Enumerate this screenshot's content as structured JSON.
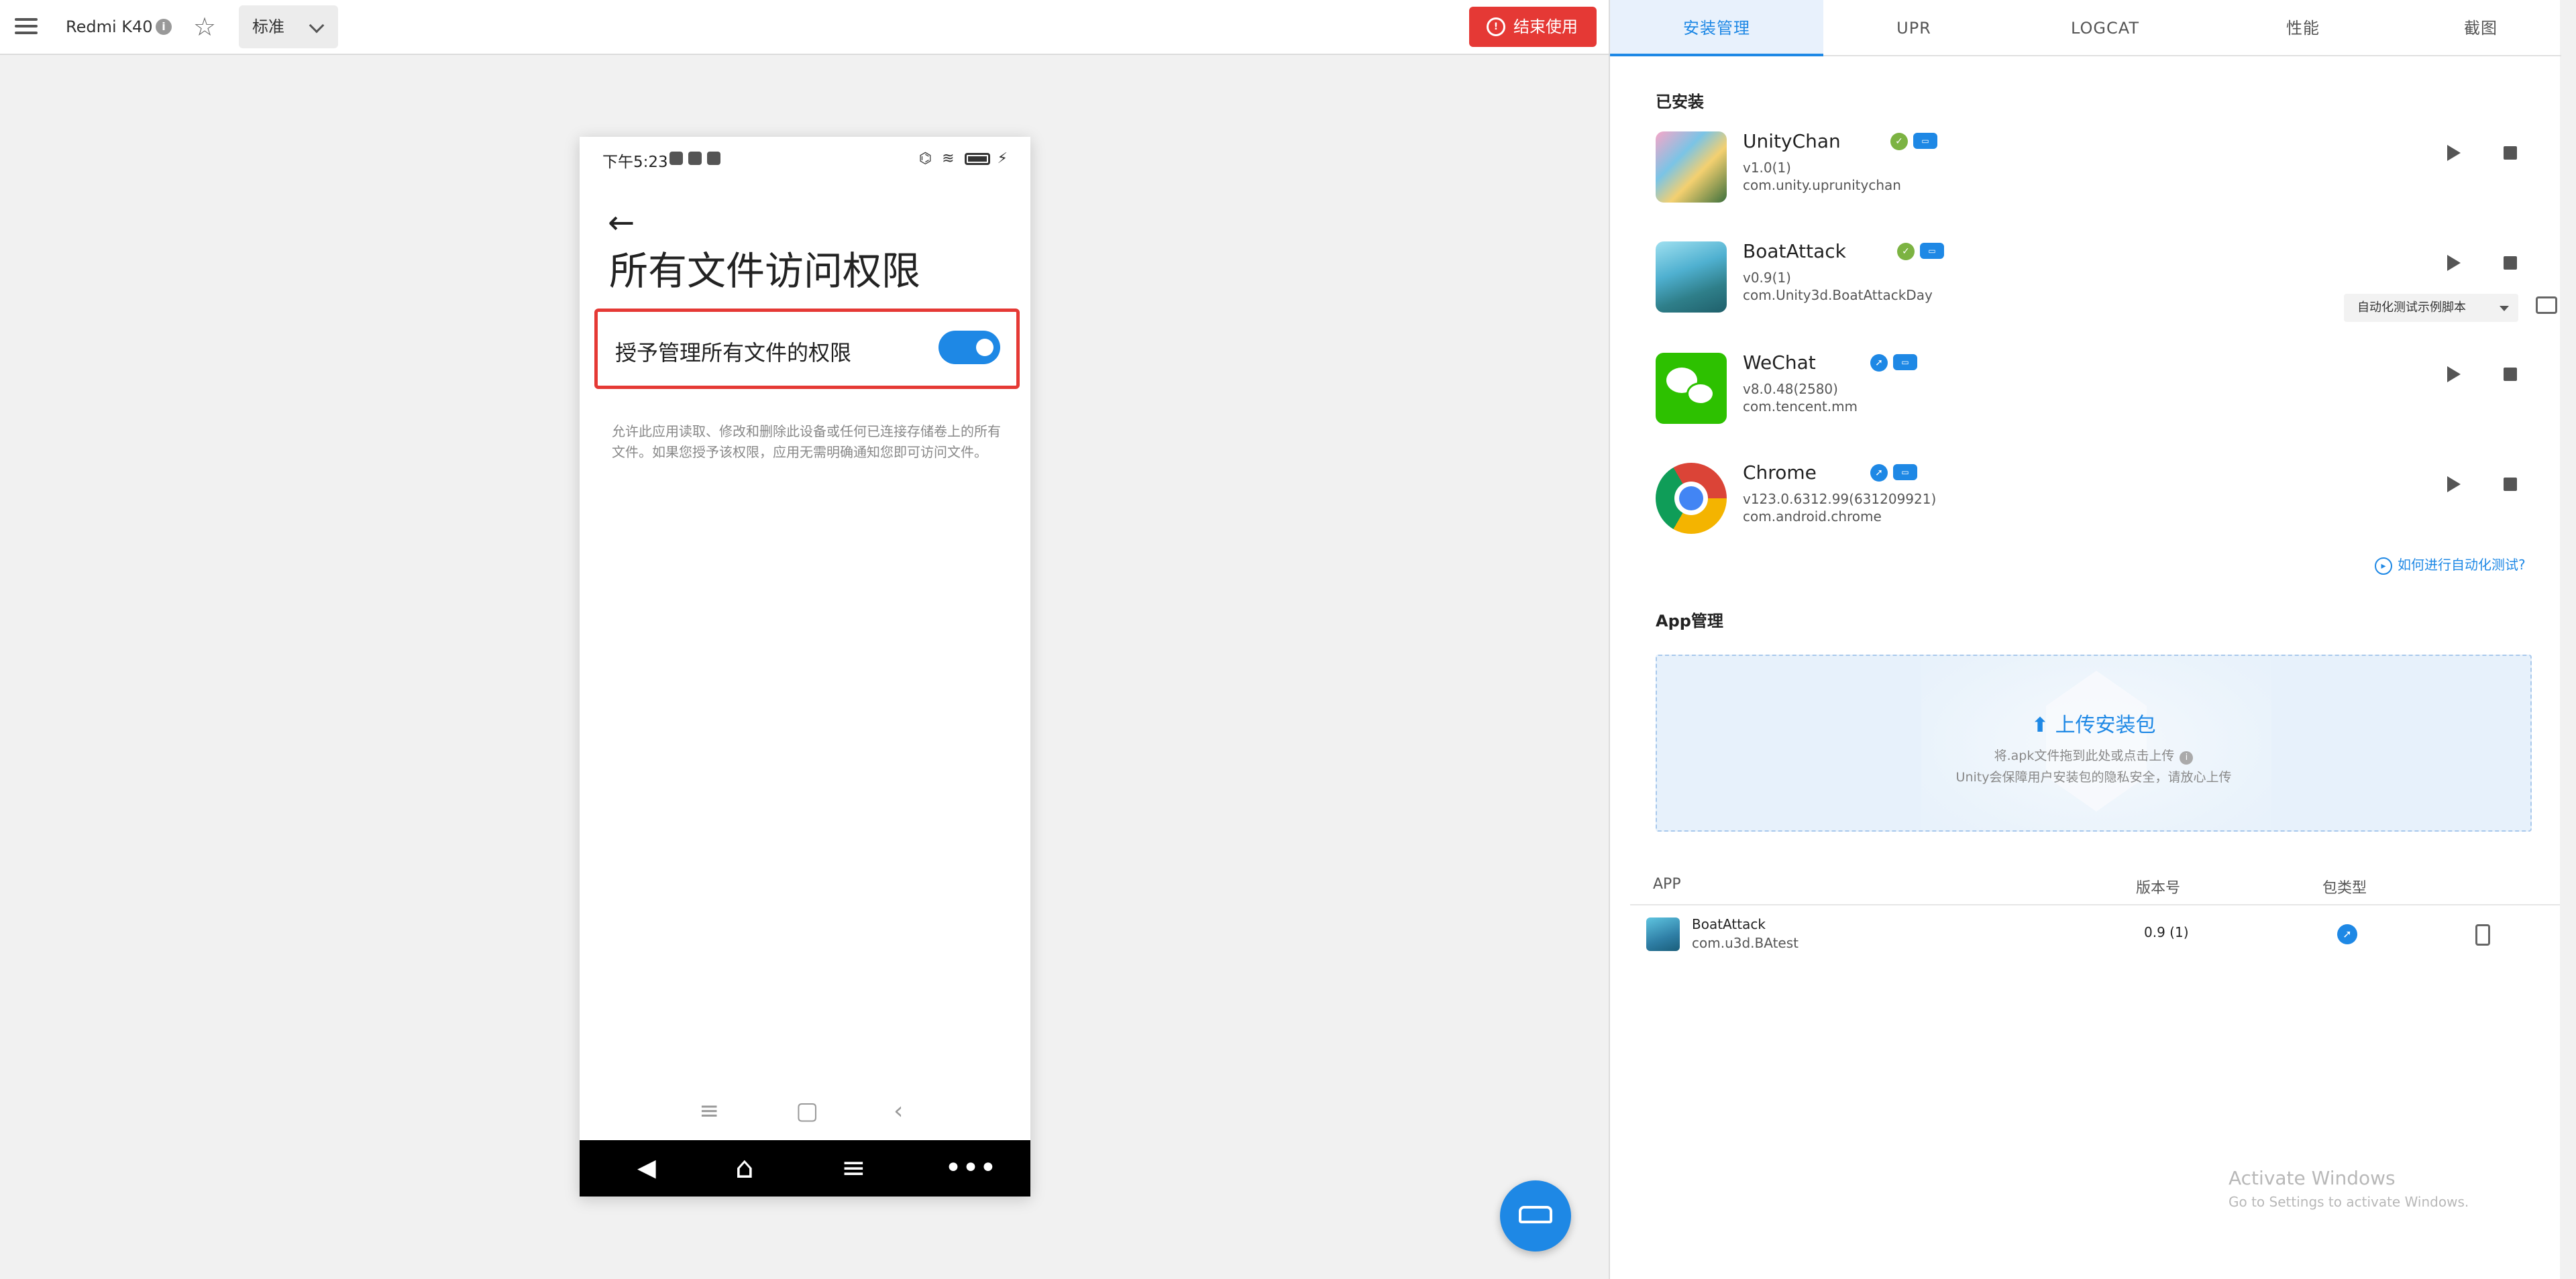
{
  "toolbar": {
    "device_name": "Redmi K40",
    "mode": "标准",
    "end_button": "结束使用"
  },
  "phone": {
    "status_time": "下午5:23",
    "page_title": "所有文件访问权限",
    "permission_label": "授予管理所有文件的权限",
    "permission_enabled": true,
    "permission_desc": "允许此应用读取、修改和删除此设备或任何已连接存储卷上的所有文件。如果您授予该权限，应用无需明确通知您即可访问文件。"
  },
  "tabs": [
    "安装管理",
    "UPR",
    "LOGCAT",
    "性能",
    "截图"
  ],
  "installed": {
    "title": "已安装",
    "apps": [
      {
        "name": "UnityChan",
        "version": "v1.0(1)",
        "package": "com.unity.uprunitychan"
      },
      {
        "name": "BoatAttack",
        "version": "v0.9(1)",
        "package": "com.Unity3d.BoatAttackDay",
        "script": "自动化测试示例脚本"
      },
      {
        "name": "WeChat",
        "version": "v8.0.48(2580)",
        "package": "com.tencent.mm"
      },
      {
        "name": "Chrome",
        "version": "v123.0.6312.99(631209921)",
        "package": "com.android.chrome"
      }
    ],
    "help_link": "如何进行自动化测试?"
  },
  "app_mgmt": {
    "title": "App管理",
    "upload_title": "上传安装包",
    "upload_hint": "将.apk文件拖到此处或点击上传",
    "upload_hint2": "Unity会保障用户安装包的隐私安全，请放心上传",
    "columns": [
      "APP",
      "版本号",
      "包类型"
    ],
    "rows": [
      {
        "name": "BoatAttack",
        "package": "com.u3d.BAtest",
        "version": "0.9 (1)"
      }
    ]
  },
  "watermark": {
    "title": "Activate Windows",
    "sub": "Go to Settings to activate Windows."
  },
  "colors": {
    "accent": "#1e88e5",
    "danger": "#e53935"
  }
}
